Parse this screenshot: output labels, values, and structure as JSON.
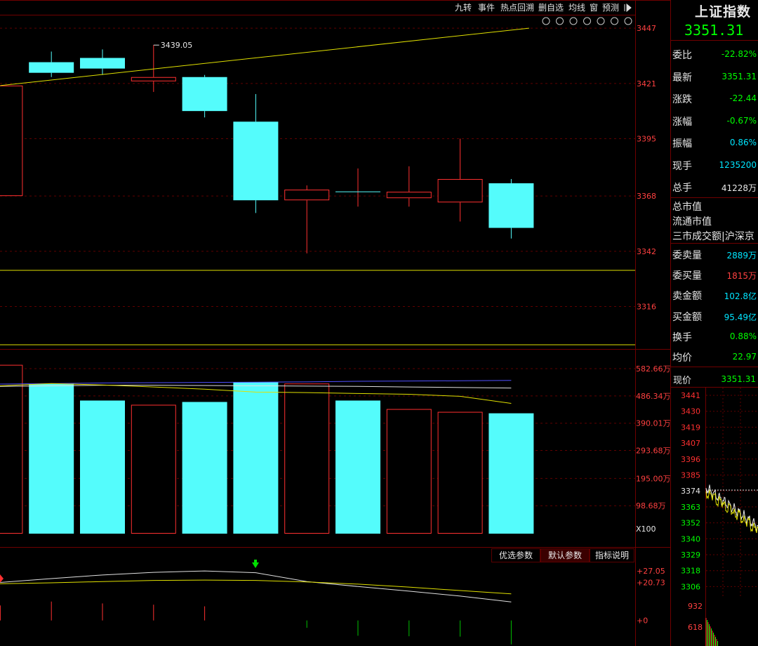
{
  "toolbar": {
    "items": [
      "九转",
      "事件",
      "热点回溯",
      "删自选",
      "均线",
      "窗",
      "预测"
    ],
    "end_icon": "collapse-right-icon"
  },
  "tool_icons": [
    "eye-icon",
    "hand-icon",
    "undo-icon",
    "scissors-icon",
    "lock-icon",
    "zoom-in-icon",
    "zoom-out-icon"
  ],
  "chart_data": [
    {
      "type": "candlestick",
      "high_annotation": "3439.05",
      "y_ticks": [
        3447,
        3421,
        3395,
        3368,
        3342,
        3316
      ],
      "ylim": [
        3296,
        3453
      ],
      "candles": [
        {
          "open": 3368,
          "close": 3420,
          "high": 3420,
          "low": 3368,
          "dir": "up"
        },
        {
          "open": 3426,
          "close": 3431,
          "high": 3436,
          "low": 3424,
          "dir": "down"
        },
        {
          "open": 3428,
          "close": 3433,
          "high": 3437,
          "low": 3425,
          "dir": "down"
        },
        {
          "open": 3422,
          "close": 3424,
          "high": 3439.05,
          "low": 3417,
          "dir": "up"
        },
        {
          "open": 3424,
          "close": 3408,
          "high": 3425,
          "low": 3405,
          "dir": "down"
        },
        {
          "open": 3403,
          "close": 3366,
          "high": 3416,
          "low": 3360,
          "dir": "down"
        },
        {
          "open": 3366,
          "close": 3371,
          "high": 3373,
          "low": 3341,
          "dir": "up"
        },
        {
          "open": 3370,
          "close": 3370,
          "high": 3381,
          "low": 3363,
          "dir": "doji"
        },
        {
          "open": 3367,
          "close": 3370,
          "high": 3382,
          "low": 3363,
          "dir": "up"
        },
        {
          "open": 3365,
          "close": 3376,
          "high": 3395,
          "low": 3356,
          "dir": "up"
        },
        {
          "open": 3374,
          "close": 3353,
          "high": 3376,
          "low": 3348,
          "dir": "down"
        }
      ],
      "trend_line": [
        [
          0,
          3420
        ],
        [
          10.35,
          3447
        ]
      ],
      "h_lines": [
        3333,
        3298
      ]
    },
    {
      "type": "bar",
      "unit": "万",
      "y_ticks": [
        "582.66万",
        "486.34万",
        "390.01万",
        "293.68万",
        "195.00万",
        "98.68万"
      ],
      "y_tick_values": [
        582.66,
        486.34,
        390.01,
        293.68,
        195.0,
        98.68
      ],
      "ylim": [
        0,
        600
      ],
      "multiplier_label": "X100",
      "volumes": [
        {
          "v": 596,
          "dir": "up"
        },
        {
          "v": 530,
          "dir": "down"
        },
        {
          "v": 470,
          "dir": "down"
        },
        {
          "v": 455,
          "dir": "up"
        },
        {
          "v": 465,
          "dir": "down"
        },
        {
          "v": 535,
          "dir": "down"
        },
        {
          "v": 530,
          "dir": "up"
        },
        {
          "v": 470,
          "dir": "down"
        },
        {
          "v": 440,
          "dir": "up"
        },
        {
          "v": 430,
          "dir": "up"
        },
        {
          "v": 425,
          "dir": "down"
        }
      ],
      "ma_lines": [
        {
          "color": "#5050ff",
          "values": [
            528,
            530,
            532,
            533,
            534,
            535,
            536,
            538,
            539,
            540,
            541
          ]
        },
        {
          "color": "#e0e0e0",
          "values": [
            520,
            522,
            524,
            524,
            523,
            522,
            521,
            520,
            518,
            516,
            514
          ]
        },
        {
          "color": "#e0e000",
          "values": [
            522,
            530,
            525,
            518,
            510,
            500,
            498,
            495,
            492,
            485,
            460
          ]
        }
      ]
    },
    {
      "type": "line",
      "y_ticks": [
        "+27.05",
        "+20.73",
        "+0"
      ],
      "y_tick_values": [
        27.05,
        20.73,
        0
      ],
      "ylim": [
        -12,
        32
      ],
      "lines": [
        {
          "color": "#e0e0e0",
          "values": [
            20.7,
            22.8,
            24.8,
            26.2,
            27.0,
            26.0,
            21.2,
            18.5,
            16.0,
            13.3,
            10.1
          ]
        },
        {
          "color": "#e0e000",
          "values": [
            20.0,
            20.5,
            21.2,
            21.8,
            22.0,
            21.8,
            21.0,
            19.8,
            18.2,
            16.3,
            14.5
          ]
        }
      ],
      "histogram": [
        8.2,
        10.3,
        9.3,
        8.6,
        7.7,
        0,
        -4.0,
        -8.3,
        -8.6,
        -8.8,
        -13.0
      ],
      "buttons": [
        "优选参数",
        "默认参数",
        "指标说明"
      ]
    }
  ],
  "quote": {
    "index_name": "上证指数",
    "price": "3351.31",
    "rows": [
      {
        "key": "委比",
        "value": "-22.82%",
        "color": "#00ff00"
      },
      {
        "key": "最新",
        "value": "3351.31",
        "color": "#00ff00"
      },
      {
        "key": "涨跌",
        "value": "-22.44",
        "color": "#00ff00"
      },
      {
        "key": "涨幅",
        "value": "-0.67%",
        "color": "#00ff00"
      },
      {
        "key": "振幅",
        "value": "0.86%",
        "color": "#00e5ff"
      },
      {
        "key": "现手",
        "value": "1235200",
        "color": "#00e5ff"
      },
      {
        "key": "总手",
        "value": "41228万",
        "color": "#e8e8e8"
      }
    ],
    "plain_rows": [
      "总市值",
      "流通市值",
      "三市成交额|沪深京"
    ],
    "rows2": [
      {
        "key": "委卖量",
        "value": "2889万",
        "color": "#00e5ff"
      },
      {
        "key": "委买量",
        "value": "1815万",
        "color": "#ff4040"
      },
      {
        "key": "卖金额",
        "value": "102.8亿",
        "color": "#00e5ff"
      },
      {
        "key": "买金额",
        "value": "95.49亿",
        "color": "#00e5ff"
      },
      {
        "key": "换手",
        "value": "0.88%",
        "color": "#00ff00"
      },
      {
        "key": "均价",
        "value": "22.97",
        "color": "#00ff00"
      }
    ],
    "now_label": "现价",
    "now_value": "3351.31"
  },
  "mini_chart": {
    "price_ticks": [
      "3441",
      "3430",
      "3419",
      "3407",
      "3396",
      "3385",
      "3374",
      "3363",
      "3352",
      "3340",
      "3329",
      "3318",
      "3306"
    ],
    "vol_ticks": [
      "932",
      "618"
    ]
  }
}
